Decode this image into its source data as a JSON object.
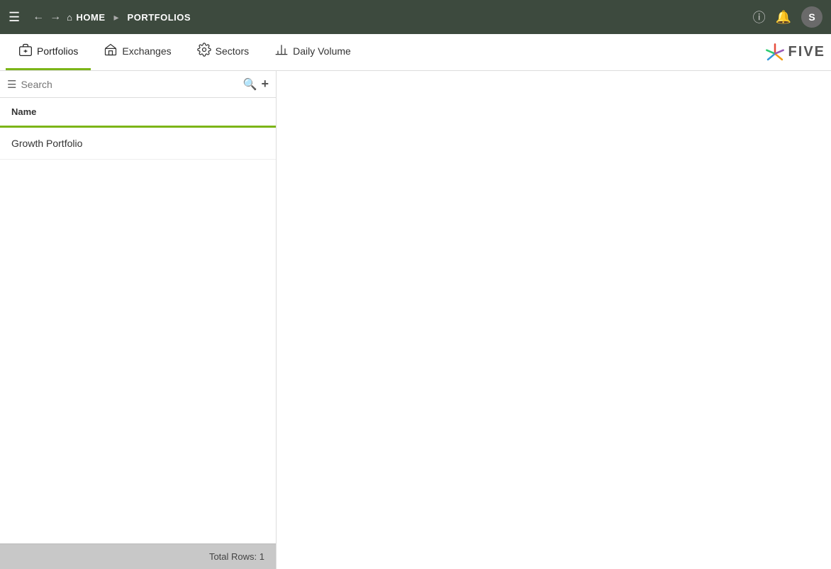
{
  "topbar": {
    "home_label": "HOME",
    "portfolios_label": "PORTFOLIOS",
    "user_initial": "S"
  },
  "tabs": [
    {
      "id": "portfolios",
      "label": "Portfolios",
      "icon": "portfolios",
      "active": true
    },
    {
      "id": "exchanges",
      "label": "Exchanges",
      "icon": "exchanges",
      "active": false
    },
    {
      "id": "sectors",
      "label": "Sectors",
      "icon": "sectors",
      "active": false
    },
    {
      "id": "daily-volume",
      "label": "Daily Volume",
      "icon": "daily-volume",
      "active": false
    }
  ],
  "search": {
    "placeholder": "Search"
  },
  "table": {
    "header": "Name",
    "rows": [
      {
        "name": "Growth Portfolio"
      }
    ],
    "footer": "Total Rows: 1"
  }
}
